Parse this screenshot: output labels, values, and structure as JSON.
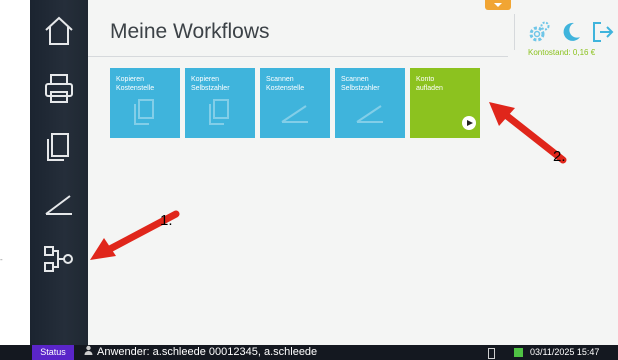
{
  "page": {
    "title": "Meine Workflows"
  },
  "account": {
    "balance": "Kontostand: 0,16 €"
  },
  "sidebar": {
    "items": [
      {
        "name": "home",
        "icon": "home-icon"
      },
      {
        "name": "print",
        "icon": "printer-icon"
      },
      {
        "name": "copy",
        "icon": "copy-icon"
      },
      {
        "name": "scan",
        "icon": "scan-icon"
      },
      {
        "name": "workflows",
        "icon": "workflow-icon"
      }
    ]
  },
  "header_icons": [
    "settings-gear-icon",
    "moon-icon",
    "logout-icon"
  ],
  "workflows": [
    {
      "line1": "Kopieren",
      "line2": "Kostenstelle",
      "icon": "copy-icon",
      "color": "#3fb4dc"
    },
    {
      "line1": "Kopieren",
      "line2": "Selbstzahler",
      "icon": "copy-icon",
      "color": "#3fb4dc"
    },
    {
      "line1": "Scannen",
      "line2": "Kostenstelle",
      "icon": "scan-icon",
      "color": "#3fb4dc"
    },
    {
      "line1": "Scannen",
      "line2": "Selbstzahler",
      "icon": "scan-icon",
      "color": "#3fb4dc"
    },
    {
      "line1": "Konto",
      "line2": "aufladen",
      "icon": "play-icon",
      "color": "#8cc21f"
    }
  ],
  "annotations": {
    "a1": "1.",
    "a2": "2."
  },
  "stray_mark": "-",
  "status": {
    "button": "Status",
    "user_text": "Anwender: a.schleede 00012345, a.schleede",
    "datetime": "03/11/2025 15:47"
  },
  "colors": {
    "accent_blue": "#3fb4dc",
    "accent_green": "#8cc21f",
    "status_purple": "#5a25c9",
    "annotation_red": "#e0261b"
  }
}
